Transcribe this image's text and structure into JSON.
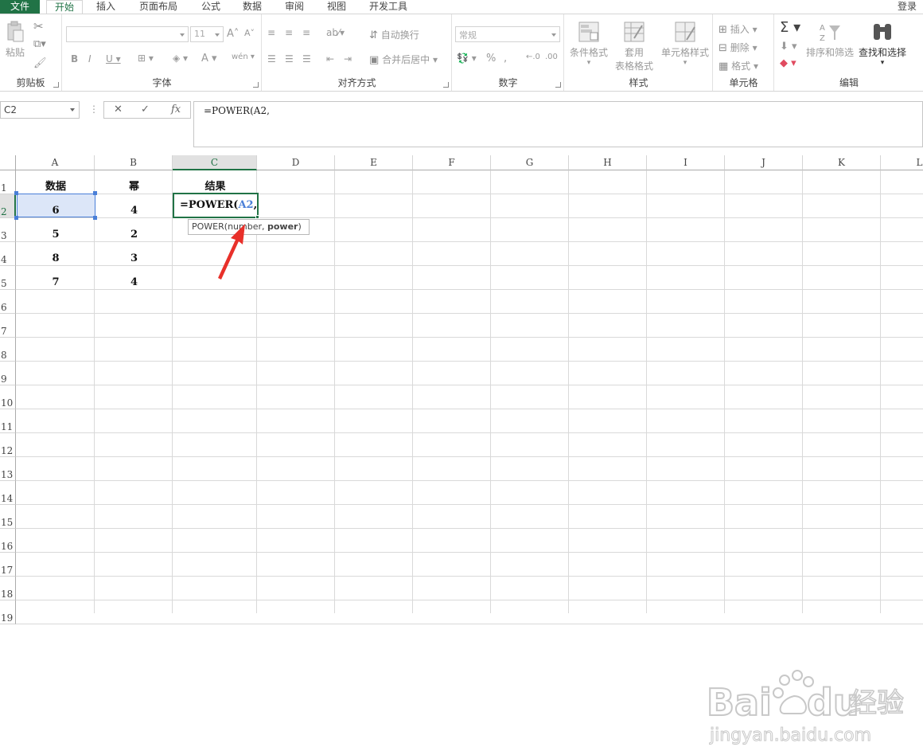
{
  "tabs": [
    "文件",
    "开始",
    "插入",
    "页面布局",
    "公式",
    "数据",
    "审阅",
    "视图",
    "开发工具"
  ],
  "login": "登录",
  "ribbon": {
    "clipboard": {
      "paste": "粘贴",
      "label": "剪贴板"
    },
    "font": {
      "font_size": "11",
      "label": "字体"
    },
    "alignment": {
      "wrap": "自动换行",
      "merge": "合并后居中",
      "label": "对齐方式"
    },
    "number": {
      "format": "常规",
      "label": "数字"
    },
    "styles": {
      "conditional": "条件格式",
      "table_format_1": "套用",
      "table_format_2": "表格格式",
      "cell_styles": "单元格样式",
      "label": "样式"
    },
    "cells": {
      "insert": "插入",
      "delete": "删除",
      "format": "格式",
      "label": "单元格"
    },
    "editing": {
      "sort_filter": "排序和筛选",
      "find_select": "查找和选择",
      "label": "编辑"
    }
  },
  "formula_bar": {
    "name_box": "C2",
    "cancel": "✕",
    "enter": "✓",
    "fx": "fx",
    "formula": "=POWER(A2,"
  },
  "grid": {
    "columns": [
      "A",
      "B",
      "C",
      "D",
      "E",
      "F",
      "G",
      "H",
      "I",
      "J",
      "K",
      "L"
    ],
    "rows": [
      "1",
      "2",
      "3",
      "4",
      "5",
      "6",
      "7",
      "8",
      "9",
      "10",
      "11",
      "12",
      "13",
      "14",
      "15",
      "16",
      "17",
      "18",
      "19"
    ],
    "cells": {
      "A1": "数据",
      "B1": "幂",
      "C1": "结果",
      "A2": "6",
      "B2": "4",
      "A3": "5",
      "B3": "2",
      "A4": "8",
      "B4": "3",
      "A5": "7",
      "B5": "4"
    },
    "editing_prefix": "=POWER(",
    "editing_ref": "A2",
    "editing_suffix": ",",
    "tooltip": {
      "name": "POWER(",
      "arg1": "number",
      "sep": ", ",
      "arg2": "power",
      "close": ")"
    }
  },
  "watermark": {
    "brand": "Bai",
    "brand2": "du",
    "cn": "经验",
    "url": "jingyan.baidu.com"
  },
  "colors": {
    "excel_green": "#217346",
    "selection_blue": "#4a7fd8",
    "arrow_red": "#e8302a"
  }
}
